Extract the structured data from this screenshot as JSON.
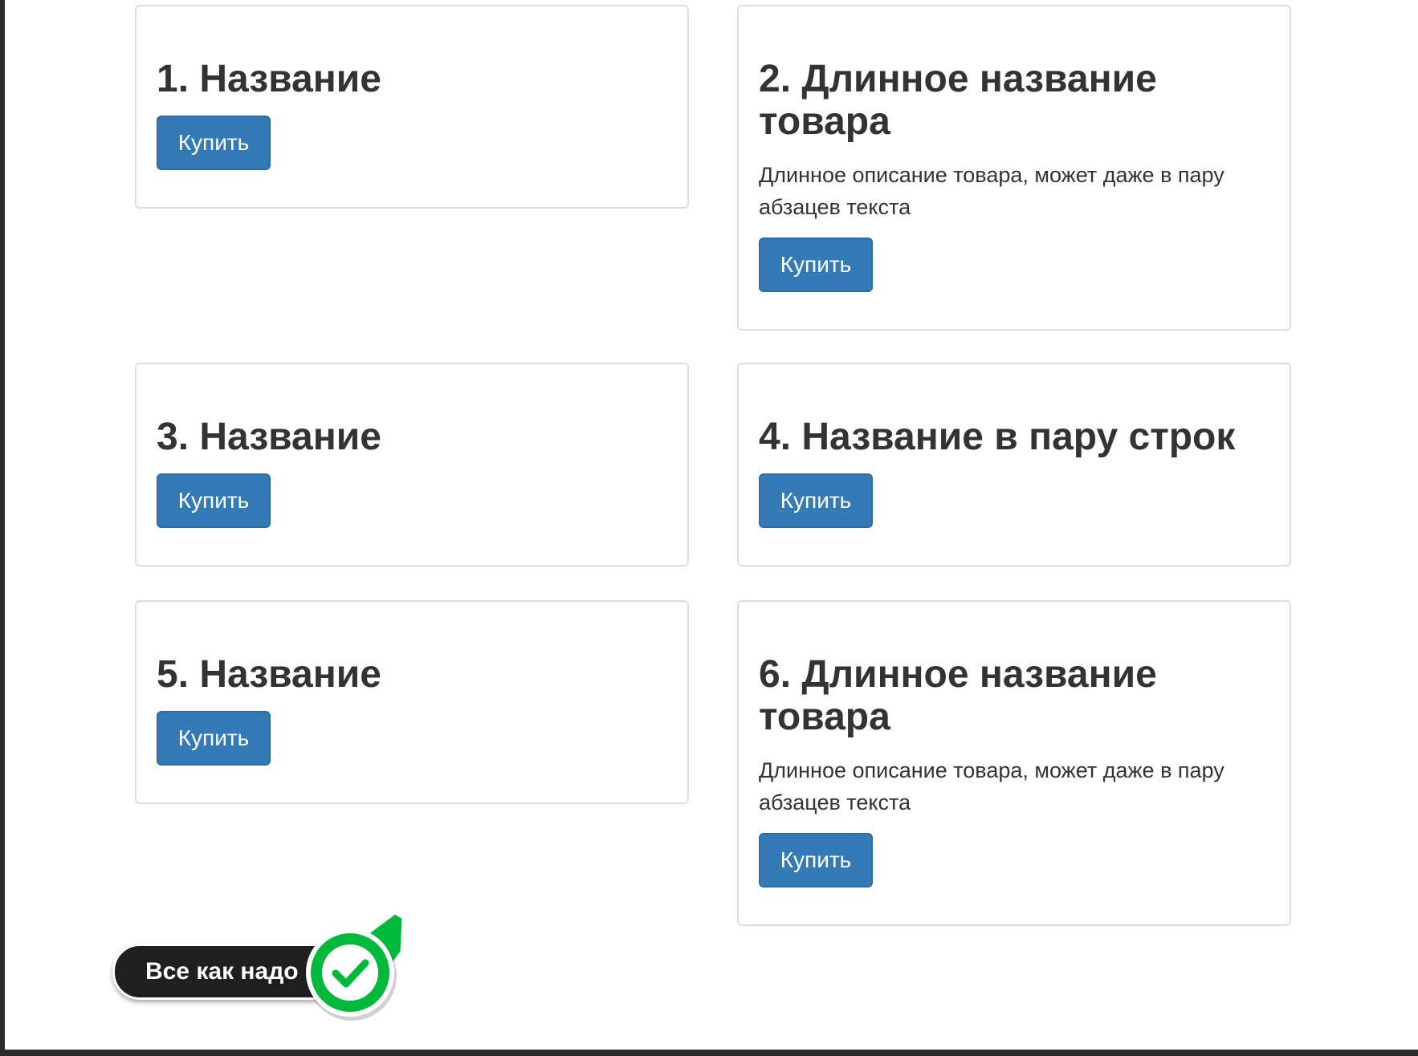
{
  "cards": [
    {
      "title": "1. Название",
      "button": "Купить"
    },
    {
      "title": "2. Длинное название товара",
      "description": "Длинное описание товара, может даже в пару абзацев текста",
      "button": "Купить"
    },
    {
      "title": "3. Название",
      "button": "Купить"
    },
    {
      "title": "4. Название в пару строк",
      "button": "Купить"
    },
    {
      "title": "5. Название",
      "button": "Купить"
    },
    {
      "title": "6. Длинное название товара",
      "description": "Длинное описание товара, может даже в пару абзацев текста",
      "button": "Купить"
    }
  ],
  "badge": {
    "text": "Все как надо",
    "icon": "checkmark-icon"
  },
  "colors": {
    "button": "#337ab7",
    "badge_green": "#00b93a",
    "text": "#333333",
    "card_border": "#dddddd"
  }
}
